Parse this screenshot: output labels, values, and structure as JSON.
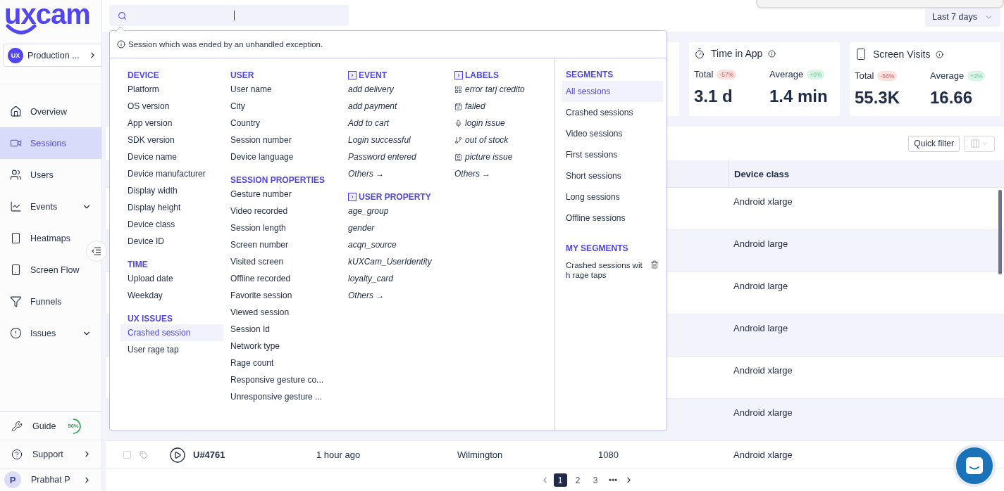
{
  "sidebar": {
    "logo": "uxcam",
    "project": {
      "badge": "UX",
      "name": "Production ..."
    },
    "nav": [
      {
        "label": "Overview",
        "selected": false,
        "submenu": false
      },
      {
        "label": "Sessions",
        "selected": true,
        "submenu": false
      },
      {
        "label": "Users",
        "selected": false,
        "submenu": false
      },
      {
        "label": "Events",
        "selected": false,
        "submenu": true
      },
      {
        "label": "Heatmaps",
        "selected": false,
        "submenu": false
      },
      {
        "label": "Screen Flow",
        "selected": false,
        "submenu": false
      },
      {
        "label": "Funnels",
        "selected": false,
        "submenu": false
      },
      {
        "label": "Issues",
        "selected": false,
        "submenu": true
      }
    ],
    "guide": {
      "label": "Guide",
      "progress": "50%",
      "level": 0.5
    },
    "support": "Support",
    "user": {
      "initial": "P",
      "name": "Prabhat P"
    }
  },
  "topbar": {
    "date_range": "Last 7 days"
  },
  "stats": [
    {
      "title": "Time in App",
      "metrics": [
        {
          "label": "Total",
          "change": "-57%",
          "color": "#fde0e0",
          "value": "3.1 d"
        },
        {
          "label": "Average",
          "change": "+0%",
          "color": "#d9f5e6",
          "value": "1.4 min"
        }
      ]
    },
    {
      "title": "Screen Visits",
      "metrics": [
        {
          "label": "Total",
          "change": "-56%",
          "color": "#fde0e0",
          "value": "55.3K"
        },
        {
          "label": "Average",
          "change": "+2%",
          "color": "#d9f5e6",
          "value": "16.66"
        }
      ]
    }
  ],
  "table": {
    "quick_filter": "Quick filter",
    "header": {
      "device_class": "Device class"
    },
    "rows": [
      {
        "device_class": "Android xlarge"
      },
      {
        "device_class": "Android large"
      },
      {
        "device_class": "Android large"
      },
      {
        "device_class": "Android large"
      },
      {
        "device_class": "Android xlarge"
      },
      {
        "device_class": "Android xlarge"
      },
      {
        "checked": false,
        "user": "U#4761",
        "column_3": "1 hour ago",
        "column_4": "Wilmington",
        "column_5": "1080",
        "device_class": "Android xlarge"
      }
    ],
    "pages": [
      {
        "label": "1",
        "selected": true
      },
      {
        "label": "2",
        "selected": false
      },
      {
        "label": "3",
        "selected": false
      },
      {
        "label": "•••",
        "selected": false
      }
    ]
  },
  "filter_menu": {
    "hint": "Session which was ended by an unhandled exception.",
    "columns": [
      [
        {
          "title": "DEVICE",
          "kind": "property",
          "items": [
            {
              "label": "Platform",
              "selected": false
            },
            {
              "label": "OS version",
              "selected": false
            },
            {
              "label": "App version",
              "selected": false
            },
            {
              "label": "SDK version",
              "selected": false
            },
            {
              "label": "Device name",
              "selected": false
            },
            {
              "label": "Device manufacturer",
              "selected": false
            },
            {
              "label": "Display width",
              "selected": false
            },
            {
              "label": "Display height",
              "selected": false
            },
            {
              "label": "Device class",
              "selected": false
            },
            {
              "label": "Device ID",
              "selected": false
            }
          ]
        },
        {
          "title": "TIME",
          "kind": "property",
          "items": [
            {
              "label": "Upload date",
              "selected": false
            },
            {
              "label": "Weekday",
              "selected": false
            }
          ]
        },
        {
          "title": "UX ISSUES",
          "kind": "property",
          "items": [
            {
              "label": "Crashed session",
              "selected": true
            },
            {
              "label": "User rage tap",
              "selected": false
            }
          ]
        }
      ],
      [
        {
          "title": "USER",
          "kind": "property",
          "items": [
            {
              "label": "User name",
              "selected": false
            },
            {
              "label": "City",
              "selected": false
            },
            {
              "label": "Country",
              "selected": false
            },
            {
              "label": "Session number",
              "selected": false
            },
            {
              "label": "Device language",
              "selected": false
            }
          ]
        },
        {
          "title": "SESSION PROPERTIES",
          "kind": "property",
          "items": [
            {
              "label": "Gesture number",
              "selected": false
            },
            {
              "label": "Video recorded",
              "selected": false
            },
            {
              "label": "Session length",
              "selected": false
            },
            {
              "label": "Screen number",
              "selected": false
            },
            {
              "label": "Visited screen",
              "selected": false
            },
            {
              "label": "Offline recorded",
              "selected": false
            },
            {
              "label": "Favorite session",
              "selected": false
            },
            {
              "label": "Viewed session",
              "selected": false
            },
            {
              "label": "Session Id",
              "selected": false
            },
            {
              "label": "Network type",
              "selected": false
            },
            {
              "label": "Rage count",
              "selected": false
            },
            {
              "label": "Responsive gesture co...",
              "selected": false
            },
            {
              "label": "Unresponsive gesture ...",
              "selected": false
            }
          ]
        }
      ],
      [
        {
          "title": "EVENT",
          "kind": "event",
          "items": [
            {
              "label": "add delivery",
              "selected": false
            },
            {
              "label": "add payment",
              "selected": false
            },
            {
              "label": "Add to cart",
              "selected": false
            },
            {
              "label": "Login successful",
              "selected": false
            },
            {
              "label": "Password entered",
              "selected": false
            },
            {
              "label": "Others →",
              "selected": false
            }
          ]
        },
        {
          "title": "USER PROPERTY",
          "kind": "event",
          "items": [
            {
              "label": "age_group",
              "selected": false
            },
            {
              "label": "gender",
              "selected": false
            },
            {
              "label": "acqn_source",
              "selected": false
            },
            {
              "label": "kUXCam_UserIdentity",
              "selected": false
            },
            {
              "label": "loyalty_card",
              "selected": false
            },
            {
              "label": "Others →",
              "selected": false
            }
          ]
        }
      ],
      [
        {
          "title": "LABELS",
          "kind": "label",
          "items": [
            {
              "label": "error tarj credito",
              "selected": false
            },
            {
              "label": "failed",
              "selected": false
            },
            {
              "label": "login issue",
              "selected": false
            },
            {
              "label": "out of stock",
              "selected": false
            },
            {
              "label": "picture issue",
              "selected": false
            },
            {
              "label": "Others →",
              "selected": false
            }
          ]
        }
      ]
    ],
    "segments": {
      "title": "SEGMENTS",
      "items": [
        {
          "label": "All sessions",
          "selected": true
        },
        {
          "label": "Crashed sessions",
          "selected": false
        },
        {
          "label": "Video sessions",
          "selected": false
        },
        {
          "label": "First sessions",
          "selected": false
        },
        {
          "label": "Short sessions",
          "selected": false
        },
        {
          "label": "Long sessions",
          "selected": false
        },
        {
          "label": "Offline sessions",
          "selected": false
        }
      ],
      "my_title": "MY SEGMENTS",
      "my_items": [
        {
          "label": "Crashed sessions with rage taps"
        }
      ]
    }
  }
}
